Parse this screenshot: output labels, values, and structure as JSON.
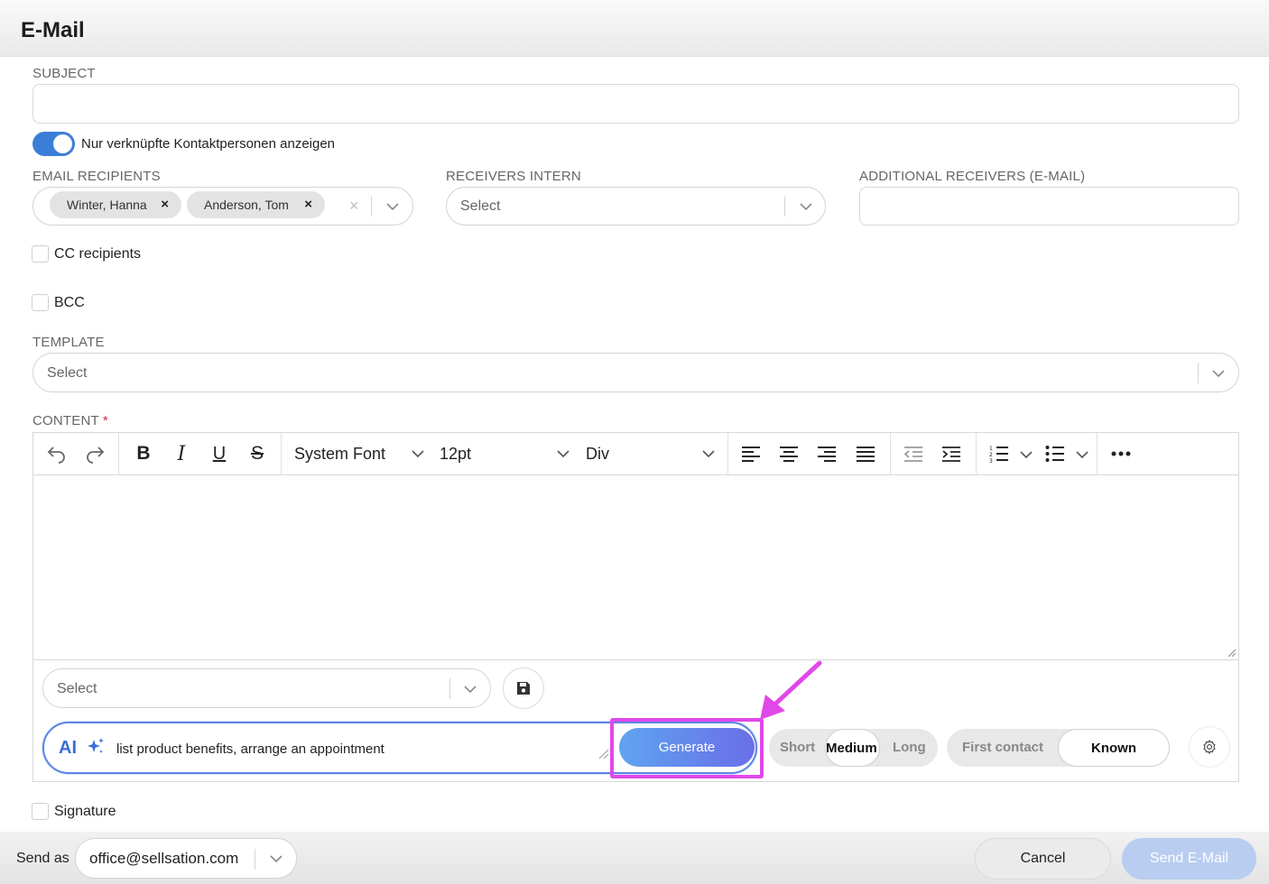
{
  "window": {
    "title": "E-Mail"
  },
  "subject": {
    "label": "SUBJECT",
    "value": ""
  },
  "linked_toggle": {
    "label": "Nur verknüpfte Kontaktpersonen anzeigen",
    "on": true
  },
  "recipients": {
    "label": "EMAIL RECIPIENTS",
    "chips": [
      "Winter, Hanna",
      "Anderson, Tom"
    ]
  },
  "receivers_intern": {
    "label": "RECEIVERS INTERN",
    "placeholder": "Select"
  },
  "additional_receivers": {
    "label": "ADDITIONAL RECEIVERS (E-MAIL)",
    "value": ""
  },
  "cc": {
    "label": "CC recipients",
    "checked": false
  },
  "bcc": {
    "label": "BCC",
    "checked": false
  },
  "template": {
    "label": "TEMPLATE",
    "placeholder": "Select"
  },
  "content": {
    "label": "CONTENT",
    "required_mark": "*",
    "toolbar": {
      "font": "System Font",
      "size": "12pt",
      "block": "Div"
    },
    "snippet_select": {
      "placeholder": "Select"
    }
  },
  "ai": {
    "label": "AI",
    "prompt": "list product benefits, arrange an appointment",
    "generate_label": "Generate",
    "length": {
      "options": [
        "Short",
        "Medium",
        "Long"
      ],
      "selected": "Medium"
    },
    "relation": {
      "options": [
        "First contact",
        "Known"
      ],
      "selected": "Known"
    }
  },
  "signature": {
    "label": "Signature",
    "checked": false
  },
  "footer": {
    "send_as_label": "Send as",
    "send_as_value": "office@sellsation.com",
    "cancel_label": "Cancel",
    "send_label": "Send E-Mail"
  },
  "colors": {
    "accent": "#3b7ed8",
    "highlight": "#e048e8",
    "required": "#e0213a"
  }
}
